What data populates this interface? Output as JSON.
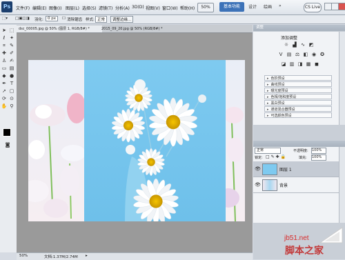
{
  "menubar": {
    "logo": "Ps",
    "items": [
      "文件(F)",
      "编辑(E)",
      "图像(I)",
      "图层(L)",
      "选择(S)",
      "滤镜(T)",
      "分析(A)",
      "3D(D)",
      "视图(V)",
      "窗口(W)",
      "帮助(H)"
    ],
    "zoom_value": "50%",
    "workspaces": [
      "基本功能",
      "设计",
      "绘画",
      "»"
    ],
    "cs_live": "CS Live"
  },
  "options": {
    "feather_label": "羽化:",
    "feather_value": "0 px",
    "antialias_label": "消除锯齿",
    "style_label": "样式:",
    "style_value": "正常",
    "refine_label": "调整边缘..."
  },
  "tabs": [
    {
      "label": "dsc_00005.jpg @ 50% (图层 1, RGB/8#) *"
    },
    {
      "label": "2015_09_20.jpg @ 50% (RGB/8#) *"
    }
  ],
  "status": {
    "zoom": "50%",
    "doc": "文档:1.37M/2.74M"
  },
  "adjustments": {
    "title": "调整",
    "subtitle": "添加调整",
    "presets": [
      "色阶预设",
      "曲线预设",
      "曝光度预设",
      "色相/饱和度预设",
      "黑白预设",
      "通道混合器预设",
      "可选颜色预设"
    ]
  },
  "layers": {
    "blend_mode": "正常",
    "opacity_label": "不透明度:",
    "opacity_value": "100%",
    "lock_label": "锁定:",
    "fill_label": "填充:",
    "fill_value": "100%",
    "items": [
      {
        "name": "图层 1"
      },
      {
        "name": "背景"
      }
    ]
  },
  "watermark": {
    "site": "jb51.net",
    "text": "脚本之家"
  },
  "colors": {
    "accent": "#3c72b8",
    "canvas_bg": "#9a9a9a",
    "photo_sky": "#7dc8ef"
  }
}
